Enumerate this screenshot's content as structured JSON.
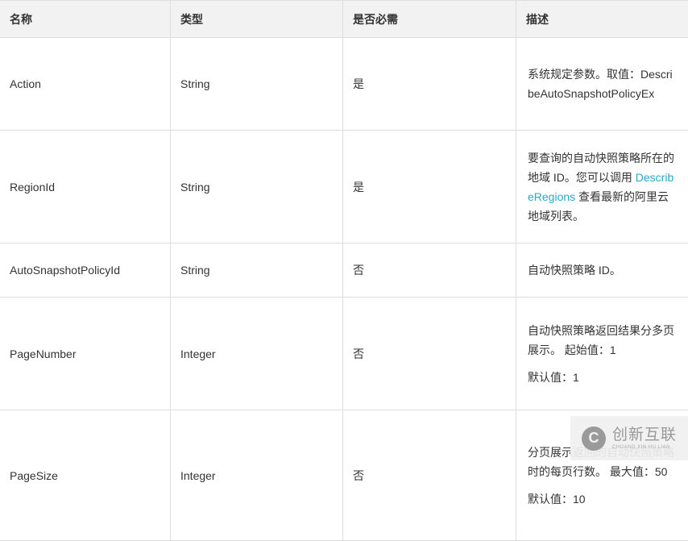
{
  "table": {
    "headers": [
      "名称",
      "类型",
      "是否必需",
      "描述"
    ],
    "rows": [
      {
        "name": "Action",
        "type": "String",
        "required": "是",
        "desc": [
          "系统规定参数。取值：DescribeAutoSnapshotPolicyEx"
        ]
      },
      {
        "name": "RegionId",
        "type": "String",
        "required": "是",
        "desc_before": "要查询的自动快照策略所在的地域 ID。您可以调用 ",
        "desc_link": "DescribeRegions",
        "desc_after": " 查看最新的阿里云地域列表。"
      },
      {
        "name": "AutoSnapshotPolicyId",
        "type": "String",
        "required": "否",
        "desc": [
          "自动快照策略 ID。"
        ]
      },
      {
        "name": "PageNumber",
        "type": "Integer",
        "required": "否",
        "desc": [
          "自动快照策略返回结果分多页展示。 起始值：1",
          "默认值：1"
        ]
      },
      {
        "name": "PageSize",
        "type": "Integer",
        "required": "否",
        "desc": [
          "分页展示返回的自动快照策略时的每页行数。 最大值：50",
          "默认值：10"
        ]
      }
    ]
  },
  "watermark": {
    "logo": "C",
    "name_cn": "创新互联",
    "name_en": "CHUANG XIN HU LIAN"
  },
  "colors": {
    "link": "#2aa8c4",
    "header_bg": "#f2f2f2",
    "border": "#dddddd"
  }
}
